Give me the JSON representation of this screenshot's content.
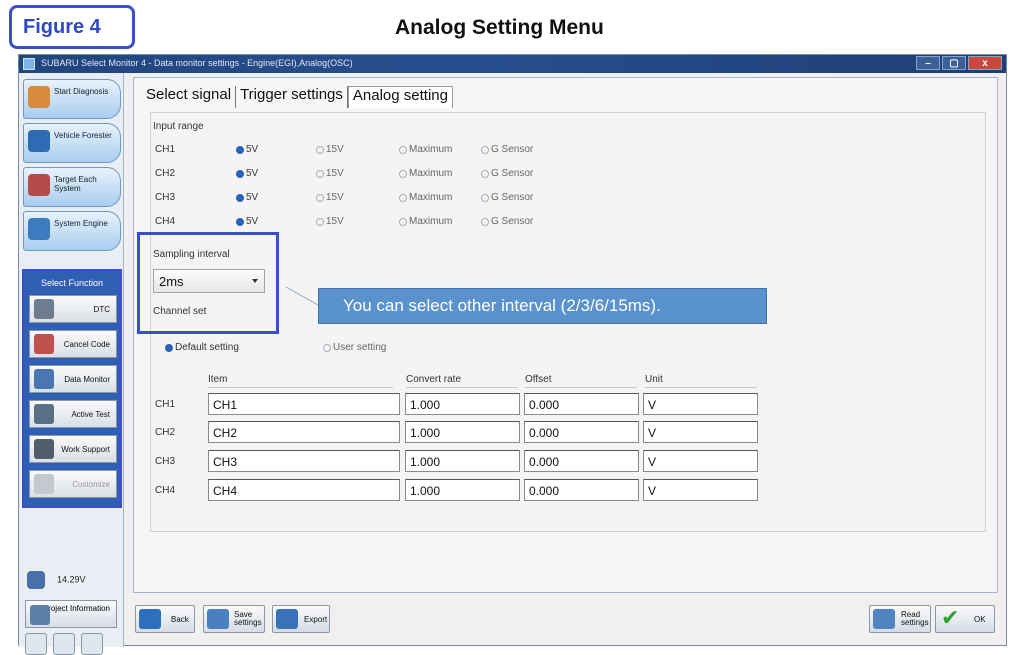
{
  "figure_label": "Figure 4",
  "headline": "Analog Setting Menu",
  "window": {
    "title": "SUBARU Select Monitor 4 - Data monitor settings - Engine(EGI),Analog(OSC)",
    "min": "–",
    "max": "▢",
    "close": "x"
  },
  "sidebar": {
    "nav": [
      {
        "label": "Start Diagnosis",
        "icon": "home-icon"
      },
      {
        "label": "Vehicle Forester",
        "icon": "car-icon"
      },
      {
        "label": "Target Each System",
        "icon": "system-target-icon"
      },
      {
        "label": "System Engine",
        "icon": "engine-icon"
      }
    ],
    "select_function": "Select Function",
    "functions": [
      {
        "label": "DTC",
        "icon": "dtc-icon",
        "enabled": true
      },
      {
        "label": "Cancel Code",
        "icon": "cancel-code-icon",
        "enabled": true
      },
      {
        "label": "Data Monitor",
        "icon": "data-monitor-icon",
        "enabled": true
      },
      {
        "label": "Active Test",
        "icon": "active-test-icon",
        "enabled": true
      },
      {
        "label": "Work Support",
        "icon": "work-support-icon",
        "enabled": true
      },
      {
        "label": "Customize",
        "icon": "customize-icon",
        "enabled": false
      }
    ],
    "voltage": "14.29V",
    "project_info": "Project Information"
  },
  "tabs": [
    "Select signal",
    "Trigger settings",
    "Analog setting"
  ],
  "active_tab": "Analog setting",
  "input_range": {
    "label": "Input range",
    "options": [
      "5V",
      "15V",
      "Maximum",
      "G Sensor"
    ],
    "channels": [
      {
        "name": "CH1",
        "selected": "5V"
      },
      {
        "name": "CH2",
        "selected": "5V"
      },
      {
        "name": "CH3",
        "selected": "5V"
      },
      {
        "name": "CH4",
        "selected": "5V"
      }
    ]
  },
  "sampling": {
    "label": "Sampling interval",
    "value": "2ms"
  },
  "callout": "You can select other interval (2/3/6/15ms).",
  "channel_set": {
    "label": "Channel set",
    "options": [
      "Default setting",
      "User setting"
    ],
    "selected": "Default setting",
    "headers": [
      "Item",
      "Convert rate",
      "Offset",
      "Unit"
    ],
    "rows": [
      {
        "ch": "CH1",
        "item": "CH1",
        "rate": "1.000",
        "offset": "0.000",
        "unit": "V"
      },
      {
        "ch": "CH2",
        "item": "CH2",
        "rate": "1.000",
        "offset": "0.000",
        "unit": "V"
      },
      {
        "ch": "CH3",
        "item": "CH3",
        "rate": "1.000",
        "offset": "0.000",
        "unit": "V"
      },
      {
        "ch": "CH4",
        "item": "CH4",
        "rate": "1.000",
        "offset": "0.000",
        "unit": "V"
      }
    ]
  },
  "toolbar": {
    "back": "Back",
    "save": "Save settings",
    "export": "Export",
    "read": "Read settings",
    "ok": "OK"
  },
  "colors": {
    "highlight": "#3a4fc9",
    "callout": "#5a92cd",
    "titlebar": "#274e8f"
  }
}
